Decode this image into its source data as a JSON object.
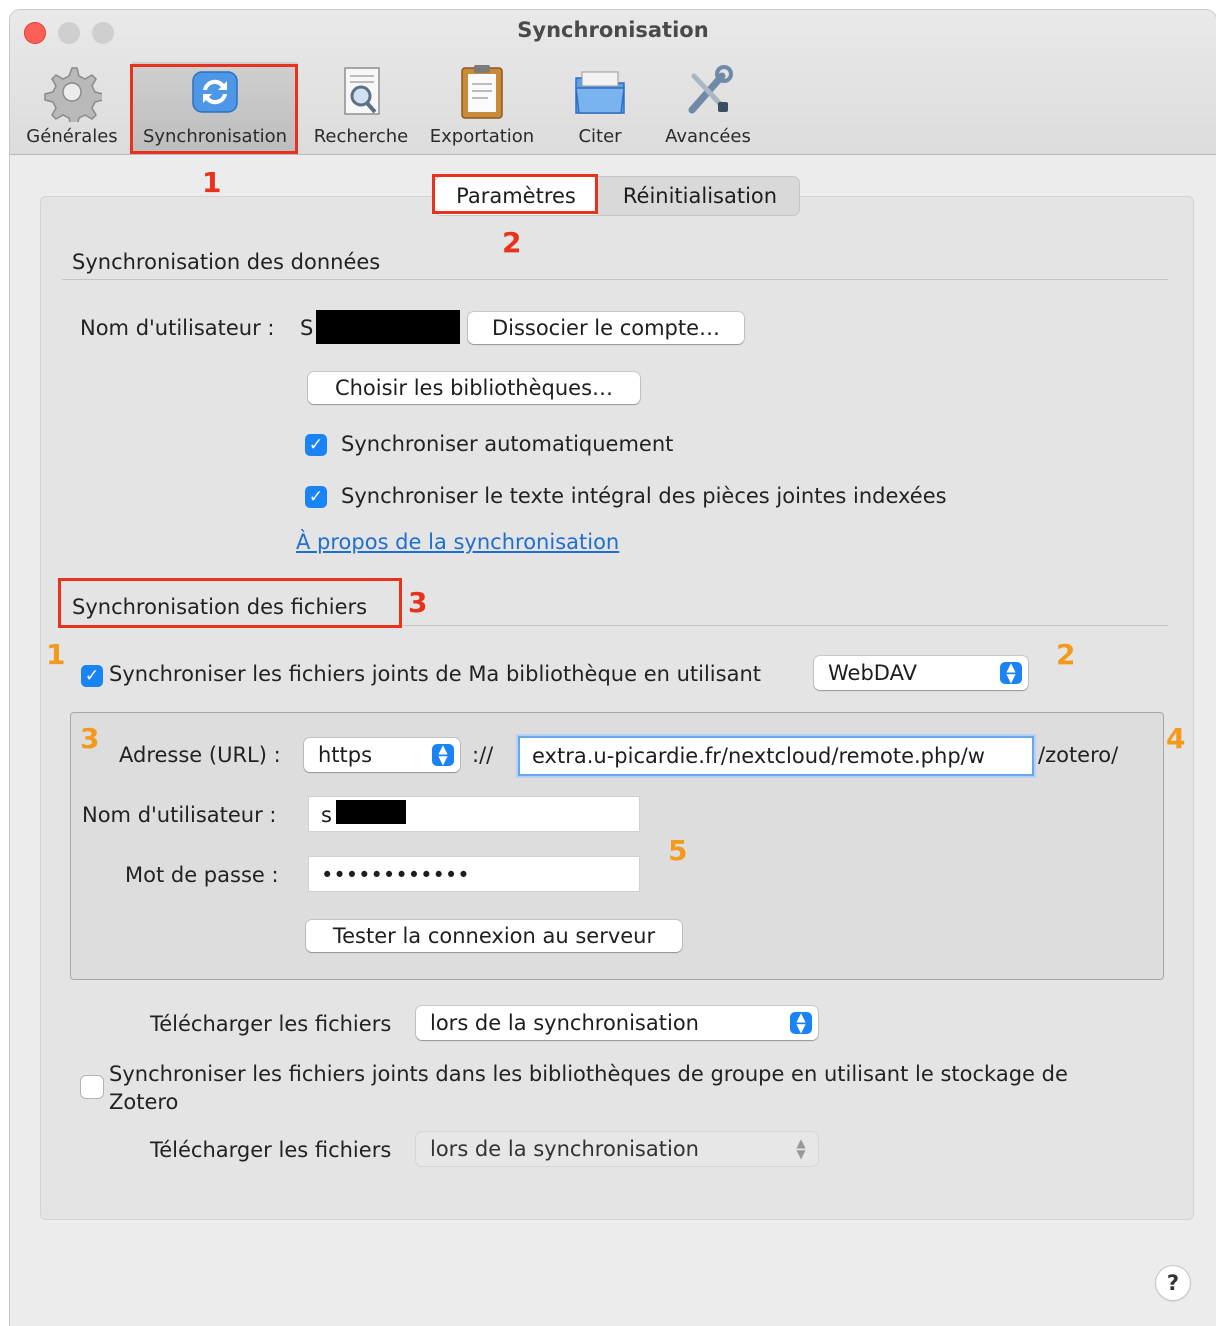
{
  "window": {
    "title": "Synchronisation"
  },
  "toolbar": {
    "items": [
      {
        "label": "Générales",
        "icon": "gear-icon"
      },
      {
        "label": "Synchronisation",
        "icon": "sync-icon"
      },
      {
        "label": "Recherche",
        "icon": "search-document-icon"
      },
      {
        "label": "Exportation",
        "icon": "clipboard-icon"
      },
      {
        "label": "Citer",
        "icon": "folder-icon"
      },
      {
        "label": "Avancées",
        "icon": "tools-icon"
      }
    ],
    "selected": "Synchronisation"
  },
  "tabs": [
    {
      "label": "Paramètres"
    },
    {
      "label": "Réinitialisation"
    }
  ],
  "data_sync": {
    "section_title": "Synchronisation des données",
    "username_label": "Nom d'utilisateur :",
    "username_prefix": "S",
    "unlink_button": "Dissocier le compte…",
    "choose_libraries_button": "Choisir les bibliothèques…",
    "auto_sync_label": "Synchroniser automatiquement",
    "auto_sync_checked": true,
    "fulltext_sync_label": "Synchroniser le texte intégral des pièces jointes indexées",
    "fulltext_sync_checked": true,
    "about_link": "À propos de la synchronisation"
  },
  "file_sync": {
    "section_title": "Synchronisation des fichiers",
    "my_library_label": "Synchroniser les fichiers joints de Ma bibliothèque en utilisant",
    "my_library_checked": true,
    "method_selected": "WebDAV",
    "url_label": "Adresse (URL) :",
    "protocol_selected": "https",
    "url_separator": "://",
    "url_value": "extra.u-picardie.fr/nextcloud/remote.php/w",
    "url_suffix": "/zotero/",
    "username_label": "Nom d'utilisateur :",
    "username_value": "s",
    "password_label": "Mot de passe :",
    "password_value": "••••••••••••",
    "test_button": "Tester la connexion au serveur",
    "download_label": "Télécharger les fichiers",
    "download_selected": "lors de la synchronisation",
    "group_label_line1": "Synchroniser les fichiers joints dans les bibliothèques de groupe en utilisant le stockage de",
    "group_label_line2": "Zotero",
    "group_checked": false,
    "group_download_label": "Télécharger les fichiers",
    "group_download_selected": "lors de la synchronisation"
  },
  "annotations": {
    "red": [
      "1",
      "2",
      "3"
    ],
    "orange": [
      "1",
      "2",
      "3",
      "4",
      "5"
    ]
  },
  "help_button": "?",
  "colors": {
    "accent": "#1a83f5",
    "annotation_red": "#e8321e",
    "annotation_orange": "#f39a1d",
    "link": "#1f6fd1"
  }
}
